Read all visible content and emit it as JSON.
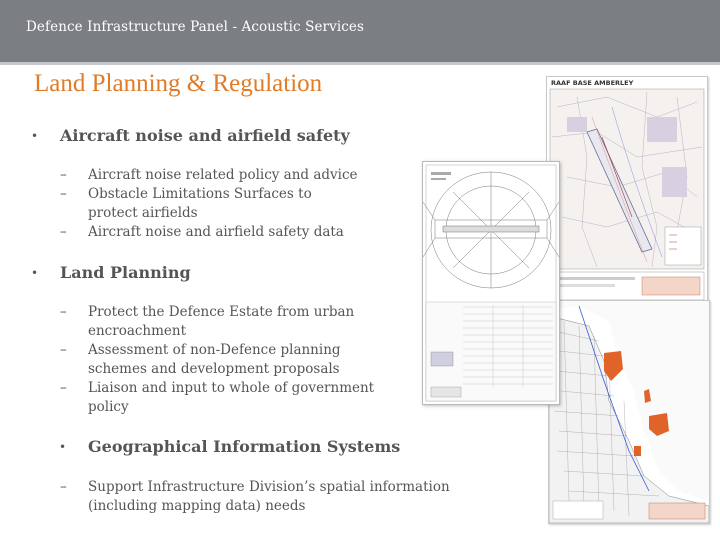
{
  "header": {
    "title": "Defence Infrastructure Panel - Acoustic Services"
  },
  "slide": {
    "title": "Land Planning & Regulation"
  },
  "sections": [
    {
      "heading": "Aircraft noise and airfield safety",
      "items": [
        "Aircraft noise related policy and advice",
        "Obstacle Limitations Surfaces to protect airfields",
        "Aircraft noise and airfield safety data"
      ]
    },
    {
      "heading": "Land Planning",
      "items": [
        "Protect the Defence Estate from urban encroachment",
        "Assessment of non-Defence planning schemes and development proposals",
        "Liaison and input to whole of government policy"
      ]
    },
    {
      "heading": "Geographical Information Systems",
      "items": [
        "Support Infrastructure Division’s spatial information (including mapping data) needs"
      ]
    }
  ],
  "images": {
    "top_map_title": "RAAF BASE AMBERLEY"
  },
  "colors": {
    "header_bg": "#7b7f84",
    "title_accent": "#e07b27",
    "body_text": "#555555"
  }
}
